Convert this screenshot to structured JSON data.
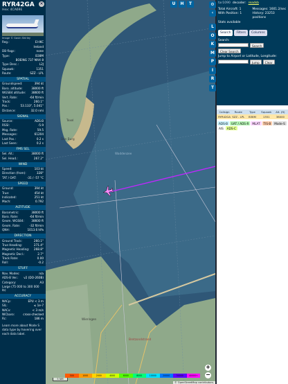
{
  "aircraft": {
    "callsign": "RYR42GA",
    "hex_label": "Hex: 4CA69E",
    "photo_credit": "Image © Gavin Shirley"
  },
  "details": [
    {
      "label": "Reg.:",
      "value": "EI-IKC"
    },
    {
      "label": "",
      "value": "Ireland"
    },
    {
      "label": "DB flags:",
      "value": "none"
    },
    {
      "label": "Type:",
      "value": "B38M"
    },
    {
      "label": "",
      "value": "BOEING 737 MAX 8"
    },
    {
      "label": "Type Desc.:",
      "value": "L2J"
    },
    {
      "label": "Squawk:",
      "value": "1351"
    },
    {
      "label": "Route:",
      "value": "SZZ - LPL"
    }
  ],
  "sections": [
    {
      "title": "SPATIAL",
      "rows": [
        {
          "label": "Groundspeed:",
          "value": "394 kt"
        },
        {
          "label": "Baro. altitude:",
          "value": "38000 ft"
        },
        {
          "label": "WGS84 altitude:",
          "value": "38600 ft"
        },
        {
          "label": "Vert. Rate:",
          "value": "-64 ft/min"
        },
        {
          "label": "Track:",
          "value": "260.1°"
        },
        {
          "label": "Pos.:",
          "value": "53.133°, 5.041°"
        },
        {
          "label": "Distance:",
          "value": "32.0 nmi"
        }
      ]
    },
    {
      "title": "SIGNAL",
      "rows": [
        {
          "label": "Source:",
          "value": "ADS-B"
        },
        {
          "label": "RSSI:",
          "value": "-5.9"
        },
        {
          "label": "Msg. Rate:",
          "value": "59.5"
        },
        {
          "label": "Messages:",
          "value": "61204"
        },
        {
          "label": "Last Pos.:",
          "value": "0.2 s"
        },
        {
          "label": "Last Seen:",
          "value": "0.2 s"
        }
      ]
    },
    {
      "title": "FMS SEL",
      "rows": [
        {
          "label": "Sel. Alt.:",
          "value": "38000 ft"
        },
        {
          "label": "Sel. Head.:",
          "value": "267.2°"
        }
      ]
    },
    {
      "title": "WIND",
      "rows": [
        {
          "label": "Speed:",
          "value": "103 kt"
        },
        {
          "label": "Direction (from):",
          "value": "328°"
        },
        {
          "label": "TAT / OAT:",
          "value": "-31 / -57 °C"
        }
      ]
    },
    {
      "title": "SPEED",
      "rows": [
        {
          "label": "Ground:",
          "value": "394 kt"
        },
        {
          "label": "True:",
          "value": "454 kt"
        },
        {
          "label": "Indicated:",
          "value": "251 kt"
        },
        {
          "label": "Mach:",
          "value": "0.792"
        }
      ]
    },
    {
      "title": "ALTITUDE",
      "rows": [
        {
          "label": "Barometric:",
          "value": "38000 ft"
        },
        {
          "label": "Baro. Rate:",
          "value": "-64 ft/min"
        },
        {
          "label": "Geom. WGS84:",
          "value": "38600 ft"
        },
        {
          "label": "Geom. Rate:",
          "value": "-32 ft/min"
        },
        {
          "label": "QNH:",
          "value": "1013.6 hPa"
        }
      ]
    },
    {
      "title": "DIRECTION",
      "rows": [
        {
          "label": "Ground Track:",
          "value": "260.1°"
        },
        {
          "label": "True Heading:",
          "value": "271.4°"
        },
        {
          "label": "Magnetic Heading:",
          "value": "268.8°"
        },
        {
          "label": "Magnetic Decl.:",
          "value": "2.7°"
        },
        {
          "label": "Track Rate:",
          "value": "0.00"
        },
        {
          "label": "Roll:",
          "value": "-0.2"
        }
      ]
    },
    {
      "title": "STUFF",
      "rows": [
        {
          "label": "Nav. Modes:",
          "value": "n/a"
        },
        {
          "label": "ADS-B Ver.:",
          "value": "v2 (DO-260B)"
        },
        {
          "label": "Category:",
          "value": "A3"
        },
        {
          "label": "Large (75 000 to 300 000 lb)",
          "value": ""
        }
      ]
    },
    {
      "title": "ACCURACY",
      "rows": [
        {
          "label": "NACp:",
          "value": "EPU < 3 m"
        },
        {
          "label": "SIL:",
          "value": "≤ 1e-7"
        },
        {
          "label": "NACv:",
          "value": "< 3 m/s"
        },
        {
          "label": "NICbaro:",
          "value": "cross-checked"
        },
        {
          "label": "Rc:",
          "value": "186 m"
        }
      ]
    }
  ],
  "footer_text": "Learn more about Mode S data type by hovering over each data label.",
  "map": {
    "top_buttons": [
      "U",
      "H",
      "T"
    ],
    "labels": {
      "texel": "Texel",
      "den_burg": "Den Burg",
      "waddenzee": "Waddenzee",
      "wieringen": "Wieringen",
      "medemblik": "Bretzondstrand"
    },
    "zoom_in": "+",
    "zoom_out": "−",
    "scale_label": "5 NM",
    "attribution": "© OpenStreetMap contributors.",
    "altitude_legend": [
      "500",
      "1000",
      "2000",
      "4000",
      "6000",
      "8000",
      "10000",
      "20000",
      "30000",
      "40000+"
    ],
    "altitude_colors": [
      "#ff5a00",
      "#ff9a00",
      "#ffd400",
      "#cfff00",
      "#54ff00",
      "#00ff7a",
      "#00e0ff",
      "#0078ff",
      "#5a00ff",
      "#ff00ff"
    ]
  },
  "side_buttons": [
    "L",
    "O",
    "K",
    "M",
    "P",
    "I",
    "R",
    "T"
  ],
  "right_panel": {
    "nav_user": "tar1090",
    "nav_decoder": "decoder:",
    "nav_link": "readsb",
    "stats": [
      {
        "label": "Total Aircraft:",
        "value": "1"
      },
      {
        "label": "Messages:",
        "value": "1601.2/sec"
      },
      {
        "label": "With Position:",
        "value": "1"
      },
      {
        "label": "History:",
        "value": "23253 positions"
      }
    ],
    "stats_link": "Stats available",
    "tabs": [
      "Search",
      "Filters",
      "Columns"
    ],
    "search_label": "Search:",
    "search_button": "Search",
    "clear_search_button": "Clear Search",
    "jump_label": "Jump to Airport or Latitude, Longitude:",
    "jump_button": "Jump",
    "clear_button": "Clear",
    "table_headers": [
      "Callsign",
      "Route",
      "Type",
      "Squawk",
      "Alt. (ft)"
    ],
    "table_row": [
      "RYR42GA",
      "SZZ - LPL",
      "B38M",
      "1351",
      "38000"
    ],
    "legend_chips": [
      {
        "label": "ADS-B",
        "color": "#c9f2ff"
      },
      {
        "label": "UAT / ADS-R",
        "color": "#b5f5b5"
      },
      {
        "label": "MLAT",
        "color": "#fbd5ff"
      },
      {
        "label": "TIS-B",
        "color": "#ffccaa"
      },
      {
        "label": "Mode-S",
        "color": "#dddddd"
      },
      {
        "label": "AIS",
        "color": "#ffffff"
      },
      {
        "label": "ADS-C",
        "color": "#e1ff93"
      }
    ]
  }
}
